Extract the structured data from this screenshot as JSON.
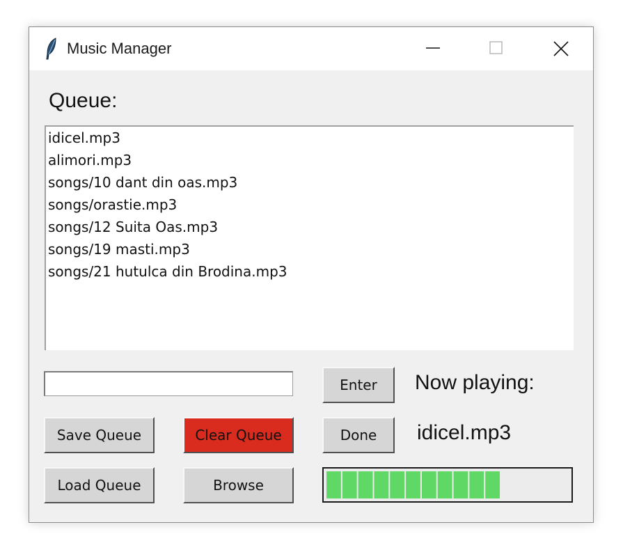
{
  "window": {
    "title": "Music Manager"
  },
  "queue_label": "Queue:",
  "queue": [
    "idicel.mp3",
    "alimori.mp3",
    "songs/10 dant din oas.mp3",
    "songs/orastie.mp3",
    "songs/12 Suita Oas.mp3",
    "songs/19 masti.mp3",
    "songs/21 hutulca din Brodina.mp3"
  ],
  "entry": {
    "value": "",
    "placeholder": ""
  },
  "buttons": {
    "enter": "Enter",
    "done": "Done",
    "save_queue": "Save Queue",
    "clear_queue": "Clear Queue",
    "load_queue": "Load Queue",
    "browse": "Browse"
  },
  "now_playing_label": "Now playing:",
  "now_playing_value": "idicel.mp3",
  "progress": {
    "segments_filled": 11,
    "fill_fraction": 0.72
  },
  "colors": {
    "clear_button": "#d92b1e",
    "progress_fill": "#5fd866",
    "window_bg": "#f0f0f0"
  },
  "icons": {
    "app": "feather-icon",
    "minimize": "minimize-icon",
    "maximize": "maximize-icon",
    "close": "close-icon"
  }
}
